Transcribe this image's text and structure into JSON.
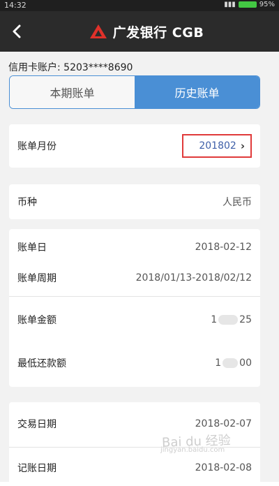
{
  "status": {
    "time": "14:32",
    "battery": "95%"
  },
  "nav": {
    "title": "广发银行 CGB"
  },
  "account": {
    "label": "信用卡账户: 5203****8690"
  },
  "tabs": [
    {
      "label": "本期账单",
      "active": false
    },
    {
      "label": "历史账单",
      "active": true
    }
  ],
  "bill_month": {
    "label": "账单月份",
    "value": "201802"
  },
  "currency": {
    "label": "币种",
    "value": "人民币"
  },
  "details": {
    "bill_date_label": "账单日",
    "bill_date_value": "2018-02-12",
    "cycle_label": "账单周期",
    "cycle_value": "2018/01/13-2018/02/12",
    "amount_label": "账单金额",
    "amount_prefix": "1",
    "amount_suffix": "25",
    "min_pay_label": "最低还款额",
    "min_pay_prefix": "1",
    "min_pay_suffix": "00"
  },
  "transaction": {
    "trans_date_label": "交易日期",
    "trans_date_value": "2018-02-07",
    "post_date_label": "记账日期",
    "post_date_value": "2018-02-08"
  },
  "watermark": {
    "brand": "Bai du 经验",
    "url": "jingyan.baidu.com"
  },
  "colors": {
    "accent": "#4a8fd5",
    "highlight_border": "#e03a3a",
    "nav_bg": "#2b2b2b"
  }
}
